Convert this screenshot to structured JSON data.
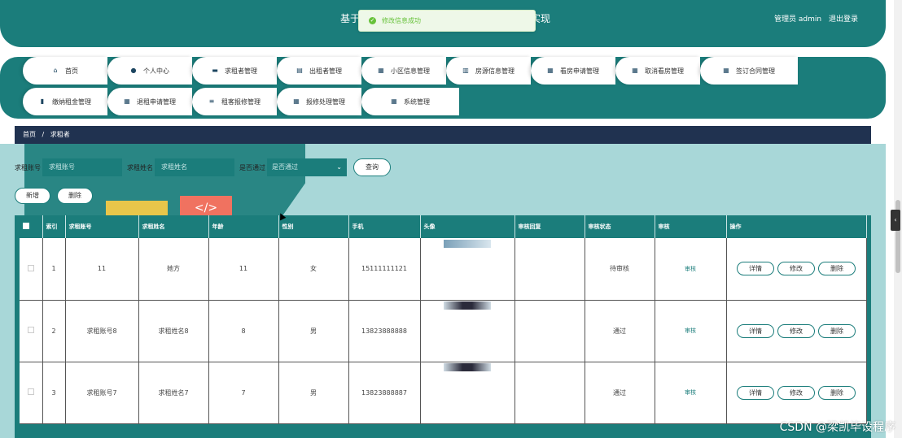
{
  "header": {
    "title_start": "基于",
    "title_end": "实现",
    "user_label": "管理员 admin",
    "logout": "退出登录"
  },
  "toast": {
    "text": "修改信息成功"
  },
  "nav": {
    "row1": [
      {
        "label": "首页",
        "icon": "home-icon",
        "glyph": "⌂"
      },
      {
        "label": "个人中心",
        "icon": "user-icon",
        "glyph": "●"
      },
      {
        "label": "求租者管理",
        "icon": "chat-icon",
        "glyph": "▬"
      },
      {
        "label": "出租者管理",
        "icon": "clipboard-icon",
        "glyph": "▤"
      },
      {
        "label": "小区信息管理",
        "icon": "grid-icon",
        "glyph": "▦"
      },
      {
        "label": "房源信息管理",
        "icon": "briefcase-icon",
        "glyph": "▥"
      },
      {
        "label": "看房申请管理",
        "icon": "grid-icon",
        "glyph": "▦"
      },
      {
        "label": "取消看房管理",
        "icon": "grid-icon",
        "glyph": "▦"
      },
      {
        "label": "签订合同管理",
        "icon": "grid-icon",
        "glyph": "▦"
      }
    ],
    "row2": [
      {
        "label": "缴纳租金管理",
        "icon": "bar-chart-icon",
        "glyph": "▮"
      },
      {
        "label": "退租申请管理",
        "icon": "grid-icon",
        "glyph": "▦"
      },
      {
        "label": "租客报修管理",
        "icon": "sliders-icon",
        "glyph": "≡"
      },
      {
        "label": "报修处理管理",
        "icon": "grid-icon",
        "glyph": "▦"
      },
      {
        "label": "系统管理",
        "icon": "grid-icon",
        "glyph": "▦"
      }
    ]
  },
  "breadcrumb": {
    "home": "首页",
    "separator": "/",
    "current": "求租者"
  },
  "search": {
    "account_label": "求租账号",
    "account_placeholder": "求租账号",
    "name_label": "求租姓名",
    "name_placeholder": "求租姓名",
    "passed_label": "是否通过",
    "passed_placeholder": "是否通过",
    "query": "查询"
  },
  "actions": {
    "add": "新增",
    "delete": "删除"
  },
  "table": {
    "headers": [
      "索引",
      "求租账号",
      "求租姓名",
      "年龄",
      "性别",
      "手机",
      "头像",
      "审核回复",
      "审核状态",
      "审核",
      "操作"
    ],
    "audit_link": "审核",
    "op_detail": "详情",
    "op_edit": "修改",
    "op_delete": "删除",
    "rows": [
      {
        "index": "1",
        "account": "11",
        "name": "她方",
        "age": "11",
        "gender": "女",
        "phone": "15111111121",
        "reply": "",
        "status": "待审核"
      },
      {
        "index": "2",
        "account": "求租账号8",
        "name": "求租姓名8",
        "age": "8",
        "gender": "男",
        "phone": "13823888888",
        "reply": "",
        "status": "通过"
      },
      {
        "index": "3",
        "account": "求租账号7",
        "name": "求租姓名7",
        "age": "7",
        "gender": "男",
        "phone": "13823888887",
        "reply": "",
        "status": "通过"
      }
    ]
  },
  "side_tab": {
    "glyph": "‹"
  },
  "watermark": "CSDN @梁凯毕设程序"
}
